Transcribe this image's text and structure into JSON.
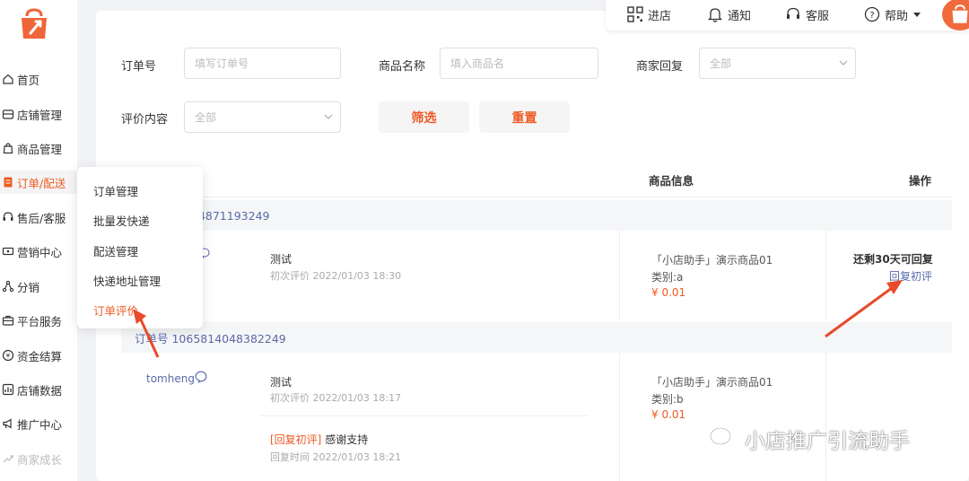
{
  "sidebar": {
    "items": [
      {
        "label": "首页",
        "icon": "home-icon"
      },
      {
        "label": "店铺管理",
        "icon": "store-icon"
      },
      {
        "label": "商品管理",
        "icon": "bag-icon"
      },
      {
        "label": "订单/配送",
        "icon": "order-icon"
      },
      {
        "label": "售后/客服",
        "icon": "headset-icon"
      },
      {
        "label": "营销中心",
        "icon": "ticket-icon"
      },
      {
        "label": "分销",
        "icon": "network-icon"
      },
      {
        "label": "平台服务",
        "icon": "briefcase-icon"
      },
      {
        "label": "资金结算",
        "icon": "coin-icon"
      },
      {
        "label": "店铺数据",
        "icon": "chart-icon"
      },
      {
        "label": "推广中心",
        "icon": "megaphone-icon"
      },
      {
        "label": "商家成长",
        "icon": "growth-icon"
      }
    ],
    "active_index": 3
  },
  "submenu": {
    "items": [
      "订单管理",
      "批量发快递",
      "配送管理",
      "快递地址管理",
      "订单评价"
    ],
    "active_index": 4
  },
  "topbar": {
    "enter_store": "进店",
    "notify": "通知",
    "service": "客服",
    "help": "帮助"
  },
  "filters": {
    "order_no_label": "订单号",
    "order_no_placeholder": "填写订单号",
    "product_name_label": "商品名称",
    "product_name_placeholder": "填入商品名",
    "merchant_reply_label": "商家回复",
    "merchant_reply_value": "全部",
    "review_content_label": "评价内容",
    "review_content_value": "全部",
    "filter_button": "筛选",
    "reset_button": "重置"
  },
  "table": {
    "columns": {
      "product_info": "商品信息",
      "actions": "操作"
    },
    "orders": [
      {
        "order_no_partial": "64871193249",
        "review_text": "测试",
        "review_time": "初次评价 2022/01/03 18:30",
        "product_name": "「小店助手」演示商品01",
        "category": "类别:a",
        "price": "¥ 0.01",
        "remaining": "还剩30天可回复",
        "reply_link": "回复初评"
      },
      {
        "order_no": "订单号 1065814048382249",
        "user": "tomheng",
        "review_text": "测试",
        "review_time": "初次评价 2022/01/03 18:17",
        "reply_tag": "[回复初评]",
        "reply_text": "感谢支持",
        "reply_time": "回复时间 2022/01/03 18:21",
        "product_name": "「小店助手」演示商品01",
        "category": "类别:b",
        "price": "¥ 0.01"
      }
    ]
  },
  "watermark": "小店推广引流助手",
  "colors": {
    "accent": "#ee5a24",
    "link": "#5a6aa8"
  }
}
